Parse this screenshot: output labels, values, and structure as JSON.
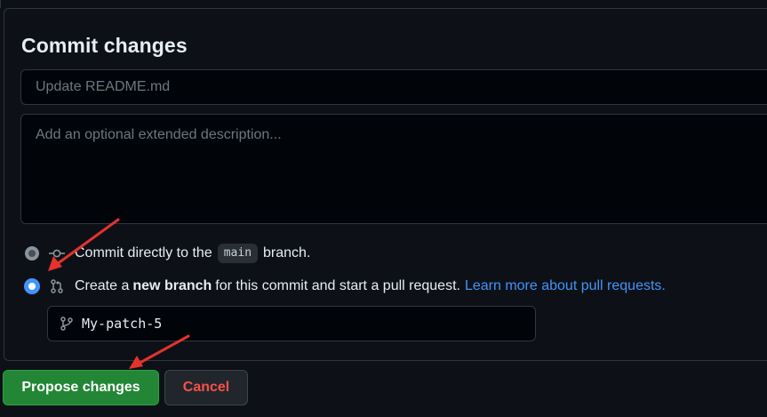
{
  "form": {
    "title": "Commit changes",
    "summary_placeholder": "Update README.md",
    "description_placeholder": "Add an optional extended description..."
  },
  "options": {
    "direct": {
      "prefix": "Commit directly to the",
      "branch": "main",
      "suffix": "branch.",
      "selected": false,
      "icon": "git-commit-icon"
    },
    "new_branch": {
      "prefix": "Create a",
      "bold": "new branch",
      "suffix": "for this commit and start a pull request.",
      "link": "Learn more about pull requests.",
      "selected": true,
      "icon": "git-pull-request-icon"
    }
  },
  "branch_input": {
    "value": "My-patch-5",
    "icon": "git-branch-icon"
  },
  "buttons": {
    "propose": "Propose changes",
    "cancel": "Cancel"
  },
  "colors": {
    "accent_blue": "#4493f8",
    "primary_green": "#238636",
    "danger_red": "#f85149",
    "annotation_red": "#e5322d"
  }
}
